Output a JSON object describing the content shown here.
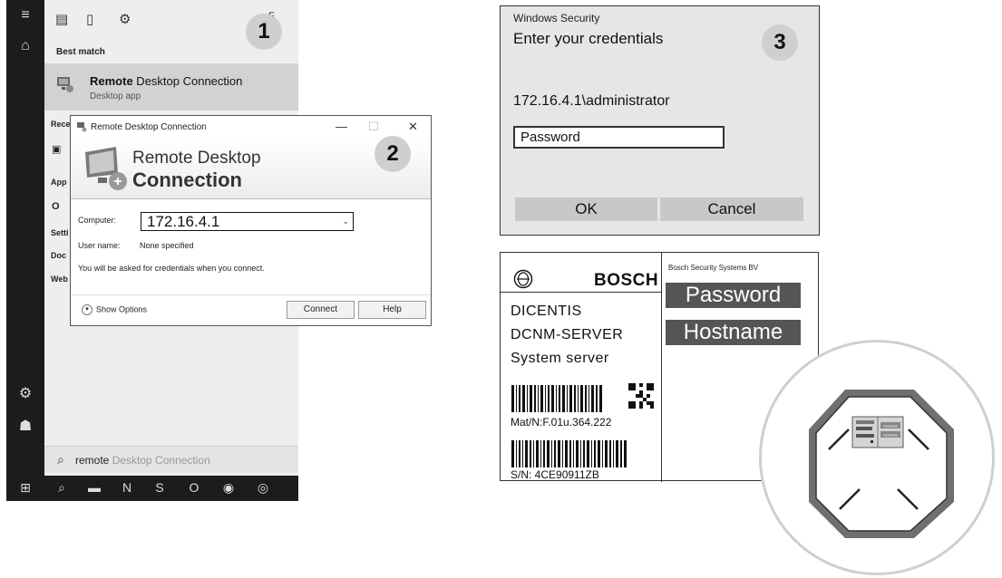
{
  "panel1": {
    "badge": "1",
    "header_partial": "F",
    "best_match_label": "Best match",
    "result": {
      "name_bold": "Remote",
      "name_rest": " Desktop Connection",
      "type": "Desktop app"
    },
    "sections": [
      "Rece",
      "App",
      "Setti",
      "Doc",
      "Web"
    ],
    "search": {
      "query": "remote",
      "suggestion": " Desktop Connection"
    }
  },
  "panel2": {
    "badge": "2",
    "window_title": "Remote Desktop Connection",
    "banner_line1": "Remote Desktop",
    "banner_line2": "Connection",
    "computer_label": "Computer:",
    "computer_value": "172.16.4.1",
    "username_label": "User name:",
    "username_value": "None specified",
    "note": "You will be asked for credentials when you connect.",
    "show_options": "Show Options",
    "connect_label": "Connect",
    "help_label": "Help"
  },
  "panel3": {
    "badge": "3",
    "app_name": "Windows Security",
    "heading": "Enter your credentials",
    "account": "172.16.4.1\\administrator",
    "password_placeholder": "Password",
    "ok_label": "OK",
    "cancel_label": "Cancel"
  },
  "panel4": {
    "brand": "BOSCH",
    "manufacturer": "Bosch Security Systems BV",
    "password_tag": "Password",
    "hostname_tag": "Hostname",
    "product_line1": "DICENTIS",
    "product_line2": "DCNM-SERVER",
    "product_line3": "System server",
    "material_number": "Mat/N:F.01u.364.222",
    "serial_number": "S/N: 4CE90911ZB"
  },
  "zoom_inset": {
    "password_tag": "Password",
    "hostname_tag": "Hostname"
  },
  "colors": {
    "start_rail": "#1c1c1c",
    "highlight": "#d2d2d2",
    "badge": "#cfcfcf",
    "label_tag": "#555555"
  }
}
